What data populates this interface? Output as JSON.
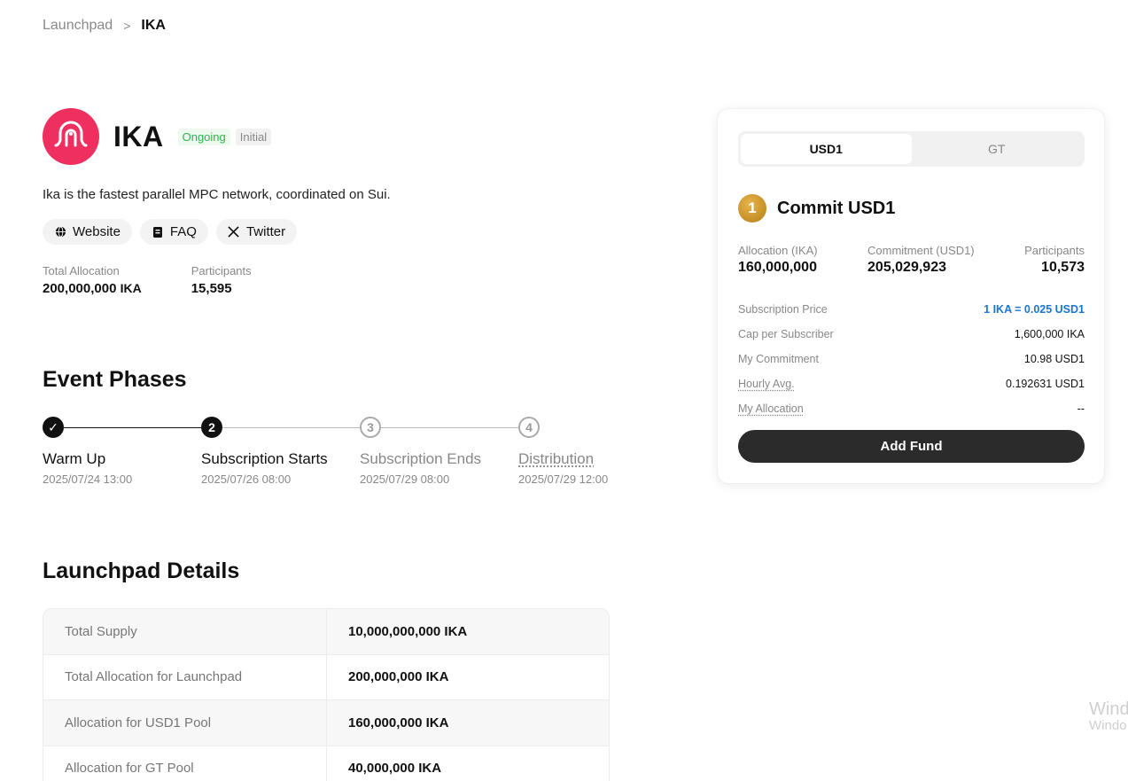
{
  "breadcrumb": {
    "parent": "Launchpad",
    "separator": ">",
    "current": "IKA"
  },
  "project": {
    "name": "IKA",
    "status_badge": "Ongoing",
    "type_badge": "Initial",
    "description": "Ika is the fastest parallel MPC network, coordinated on Sui.",
    "links": [
      {
        "label": "Website",
        "icon": "globe-icon"
      },
      {
        "label": "FAQ",
        "icon": "doc-icon"
      },
      {
        "label": "Twitter",
        "icon": "x-icon"
      }
    ],
    "stats": {
      "total_allocation_label": "Total Allocation",
      "total_allocation_value": "200,000,000",
      "total_allocation_unit": "IKA",
      "participants_label": "Participants",
      "participants_value": "15,595"
    }
  },
  "event_phases": {
    "title": "Event Phases",
    "phases": [
      {
        "step": "✓",
        "name": "Warm Up",
        "date": "2025/07/24 13:00",
        "state": "done"
      },
      {
        "step": "2",
        "name": "Subscription Starts",
        "date": "2025/07/26 08:00",
        "state": "active"
      },
      {
        "step": "3",
        "name": "Subscription Ends",
        "date": "2025/07/29 08:00",
        "state": "pending"
      },
      {
        "step": "4",
        "name": "Distribution",
        "date": "2025/07/29 12:00",
        "state": "pending"
      }
    ]
  },
  "launchpad_details": {
    "title": "Launchpad Details",
    "rows": [
      {
        "key": "Total Supply",
        "value": "10,000,000,000 IKA"
      },
      {
        "key": "Total Allocation for Launchpad",
        "value": "200,000,000 IKA"
      },
      {
        "key": "Allocation for USD1 Pool",
        "value": "160,000,000 IKA"
      },
      {
        "key": "Allocation for GT Pool",
        "value": "40,000,000 IKA"
      }
    ]
  },
  "commit_card": {
    "tabs": [
      "USD1",
      "GT"
    ],
    "active_tab": "USD1",
    "coin_glyph": "1",
    "title": "Commit USD1",
    "stats": [
      {
        "label": "Allocation (IKA)",
        "value": "160,000,000"
      },
      {
        "label": "Commitment (USD1)",
        "value": "205,029,923"
      },
      {
        "label": "Participants",
        "value": "10,573"
      }
    ],
    "rows": [
      {
        "key": "Subscription Price",
        "value": "1 IKA = 0.025 USD1"
      },
      {
        "key": "Cap per Subscriber",
        "value": "1,600,000 IKA"
      },
      {
        "key": "My Commitment",
        "value": "10.98 USD1"
      },
      {
        "key": "Hourly Avg.",
        "value": "0.192631 USD1"
      },
      {
        "key": "My Allocation",
        "value": "--"
      }
    ],
    "button_label": "Add Fund"
  },
  "watermark": {
    "line1": "Wind",
    "line2": "Windo"
  },
  "colors": {
    "brand": "#ee2f5f",
    "accent": "#1b76d2",
    "ongoing": "#2db24a",
    "button": "#2b2b2b"
  }
}
